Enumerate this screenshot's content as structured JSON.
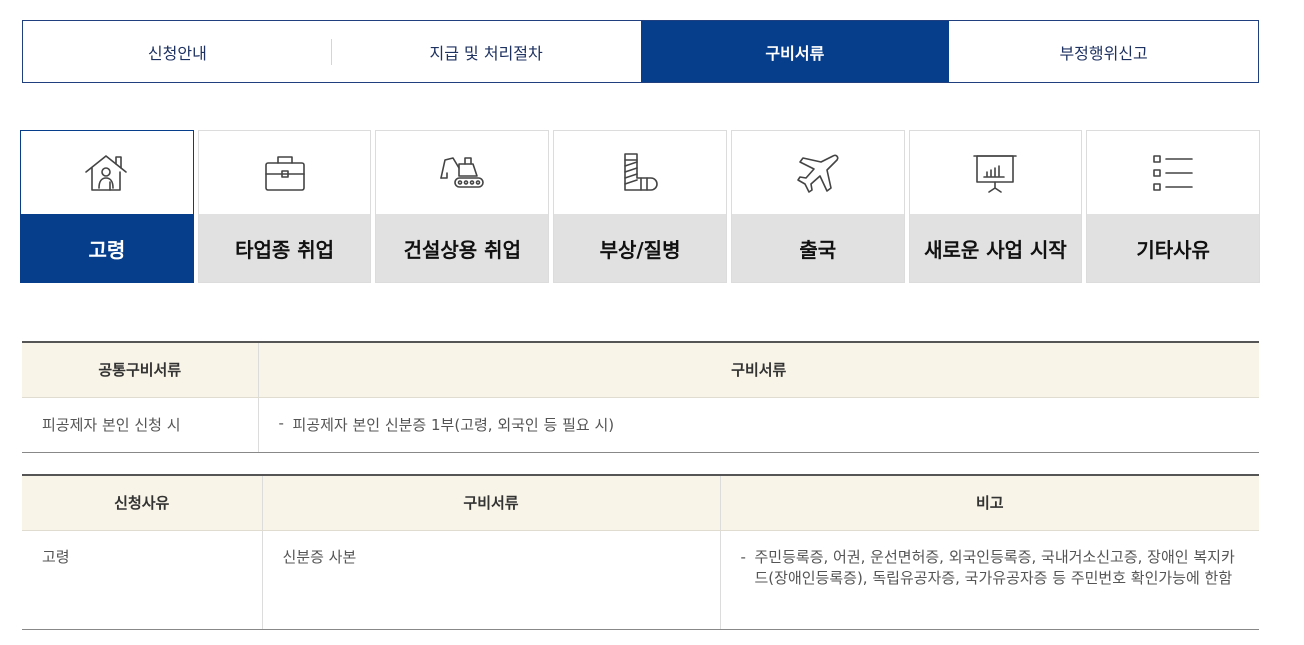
{
  "top_tabs": [
    {
      "label": "신청안내"
    },
    {
      "label": "지급 및 처리절차"
    },
    {
      "label": "구비서류"
    },
    {
      "label": "부정행위신고"
    }
  ],
  "categories": [
    {
      "label": "고령",
      "icon": "elderly-home-icon"
    },
    {
      "label": "타업종 취업",
      "icon": "briefcase-icon"
    },
    {
      "label": "건설상용 취업",
      "icon": "excavator-icon"
    },
    {
      "label": "부상/질병",
      "icon": "cast-icon"
    },
    {
      "label": "출국",
      "icon": "airplane-icon"
    },
    {
      "label": "새로운 사업 시작",
      "icon": "presentation-chart-icon"
    },
    {
      "label": "기타사유",
      "icon": "list-icon"
    }
  ],
  "common_table": {
    "headers": [
      "공통구비서류",
      "구비서류"
    ],
    "row": {
      "label": "피공제자 본인 신청 시",
      "dash": "-",
      "value": "피공제자 본인 신분증 1부(고령, 외국인 등 필요 시)"
    }
  },
  "reason_table": {
    "headers": [
      "신청사유",
      "구비서류",
      "비고"
    ],
    "row": {
      "reason": "고령",
      "document": "신분증 사본",
      "dash": "-",
      "note": "주민등록증, 어권, 운선면허증, 외국인등록증, 국내거소신고증, 장애인 복지카드(장애인등록증), 독립유공자증, 국가유공자증 등 주민번호 확인가능에 한함"
    }
  },
  "colors": {
    "accent": "#063e8b",
    "header_bg": "#f8f4e8",
    "inactive_card": "#e1e1e1"
  }
}
